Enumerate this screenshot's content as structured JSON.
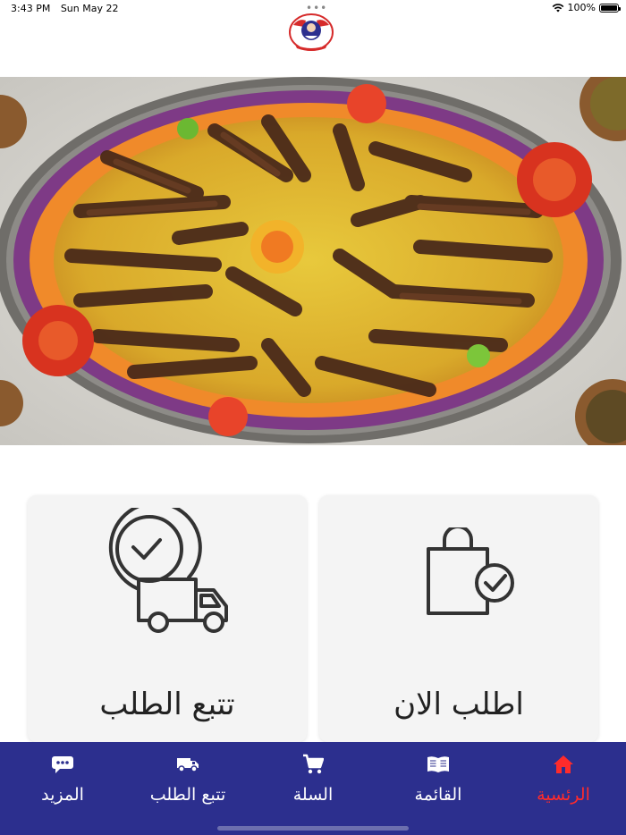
{
  "status_bar": {
    "time": "3:43 PM",
    "date": "Sun May 22",
    "battery": "100%",
    "battery_level": 1.0
  },
  "cards": {
    "track_order_label": "تتبع الطلب",
    "order_now_label": "اطلب الان"
  },
  "tabbar": {
    "items": [
      {
        "label": "المزيد",
        "icon": "chat-bubble-icon"
      },
      {
        "label": "تتبع الطلب",
        "icon": "truck-icon"
      },
      {
        "label": "السلة",
        "icon": "cart-icon"
      },
      {
        "label": "القائمة",
        "icon": "book-icon"
      },
      {
        "label": "الرئسية",
        "icon": "home-icon"
      }
    ],
    "active_index": 4
  },
  "colors": {
    "tabbar_bg": "#2c2f8e",
    "active_tab": "#ff2b2b",
    "card_bg": "#f4f4f4"
  }
}
